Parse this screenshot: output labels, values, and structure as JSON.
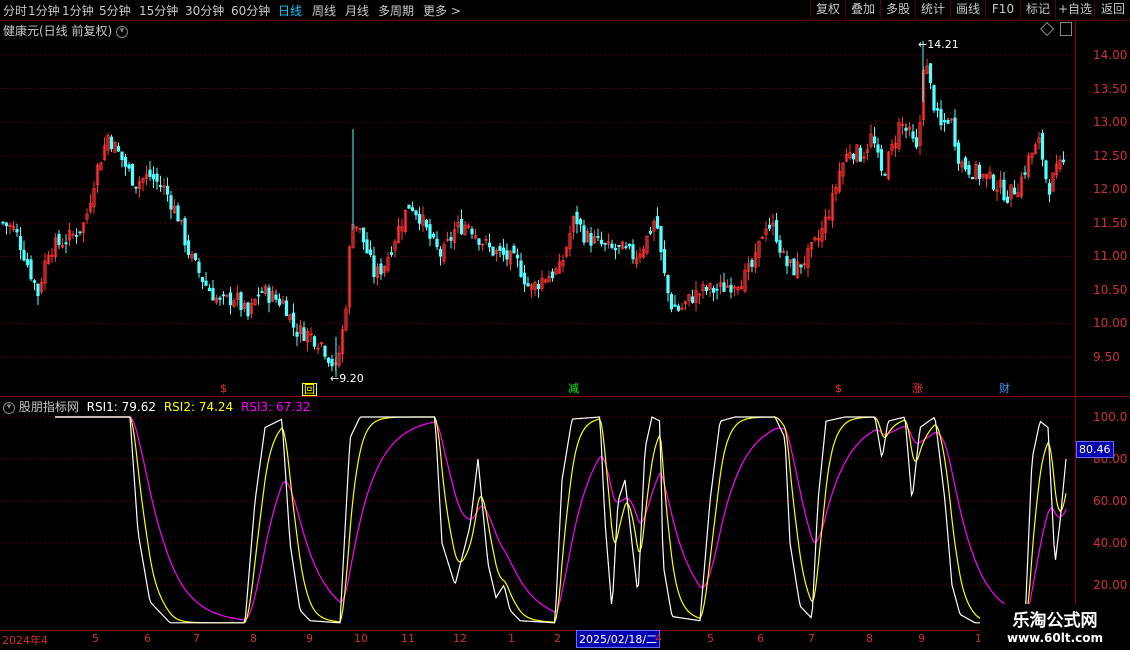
{
  "toolbar": {
    "periods": [
      "分时",
      "1分钟",
      "5分钟",
      "15分钟",
      "30分钟",
      "60分钟",
      "日线",
      "周线",
      "月线",
      "多周期",
      "更多 >"
    ],
    "active_period": "日线",
    "buttons": [
      "复权",
      "叠加",
      "多股",
      "统计",
      "画线",
      "F10",
      "标记",
      "+自选",
      "返回"
    ]
  },
  "main_chart": {
    "title": "健康元(日线 前复权)",
    "diamond_icon": "diamond-icon",
    "high_label": "14.21",
    "low_label": "9.20",
    "y_ticks": [
      "14.00",
      "13.50",
      "13.00",
      "12.50",
      "12.00",
      "11.50",
      "11.00",
      "10.50",
      "10.00",
      "9.50"
    ],
    "colors": {
      "up": "#ff3232",
      "down": "#54ffff",
      "grid": "#8b0000"
    },
    "markers": [
      {
        "text": "$",
        "color": "#ff3232"
      },
      {
        "text": "回",
        "color": "#ffff00"
      },
      {
        "text": "减",
        "color": "#00ff00"
      },
      {
        "text": "$",
        "color": "#ff3232"
      },
      {
        "text": "涨",
        "color": "#ff3232"
      },
      {
        "text": "财",
        "color": "#3a9bff"
      }
    ]
  },
  "indicator": {
    "name": "股朋指标网",
    "rsi1_label": "RSI1: 79.62",
    "rsi2_label": "RSI2: 74.24",
    "rsi3_label": "RSI3: 67.32",
    "current_value": "80.46",
    "y_ticks": [
      "100.0",
      "80.00",
      "60.00",
      "40.00",
      "20.00"
    ],
    "colors": {
      "rsi1": "#ffffff",
      "rsi2": "#ffff00",
      "rsi3": "#ff00ff"
    }
  },
  "date_axis": {
    "labels": [
      "2024年4",
      "5",
      "6",
      "7",
      "8",
      "9",
      "10",
      "11",
      "12",
      "1",
      "2",
      "2025/02/18/二",
      "4",
      "5",
      "6",
      "7",
      "8",
      "9",
      "1"
    ],
    "highlight": "2025/02/18/二"
  },
  "watermark": {
    "line1": "乐淘公式网",
    "line2": "www.60lt.com"
  }
}
